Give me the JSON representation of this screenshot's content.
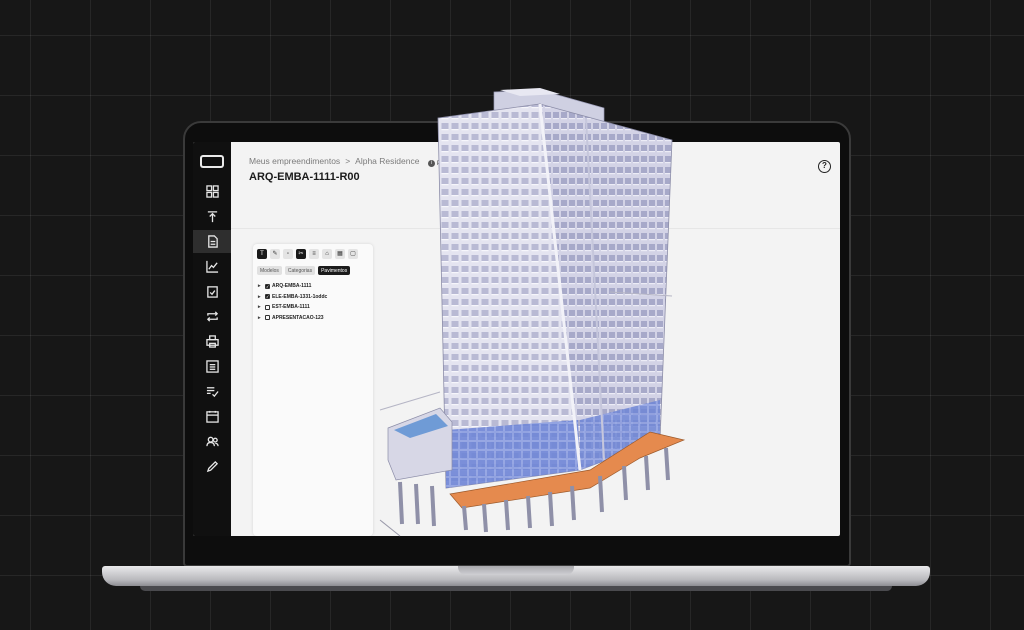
{
  "breadcrumb": {
    "root": "Meus empreendimentos",
    "separator": ">",
    "current": "Alpha Residence",
    "badge": "PL"
  },
  "page": {
    "title": "ARQ-EMBA-1111-R00"
  },
  "sidebar": {
    "items": [
      {
        "icon": "dashboard-icon",
        "active": false
      },
      {
        "icon": "upload-icon",
        "active": false
      },
      {
        "icon": "document-icon",
        "active": true
      },
      {
        "icon": "chart-icon",
        "active": false
      },
      {
        "icon": "clipboard-check-icon",
        "active": false
      },
      {
        "icon": "sync-icon",
        "active": false
      },
      {
        "icon": "printer-icon",
        "active": false
      },
      {
        "icon": "list-icon",
        "active": false
      },
      {
        "icon": "checklist-icon",
        "active": false
      },
      {
        "icon": "calendar-icon",
        "active": false
      },
      {
        "icon": "users-icon",
        "active": false
      },
      {
        "icon": "pencil-icon",
        "active": false
      }
    ]
  },
  "panel": {
    "tabs": [
      "Modelos",
      "Categorias",
      "Pavimentos"
    ],
    "active_tab": "Pavimentos",
    "models": [
      {
        "label": "ARQ-EMBA-1111",
        "checked": true
      },
      {
        "label": "ELE-EMBA-1331-1oddc",
        "checked": true
      },
      {
        "label": "EST-EMBA-1111",
        "checked": false
      },
      {
        "label": "APRESENTACAO-123",
        "checked": false
      }
    ]
  },
  "colors": {
    "background": "#171717",
    "sidebar": "#101010",
    "building_facade": "#dcdceb",
    "building_glass": "#6f86d6",
    "podium_accent": "#e58a4e"
  }
}
